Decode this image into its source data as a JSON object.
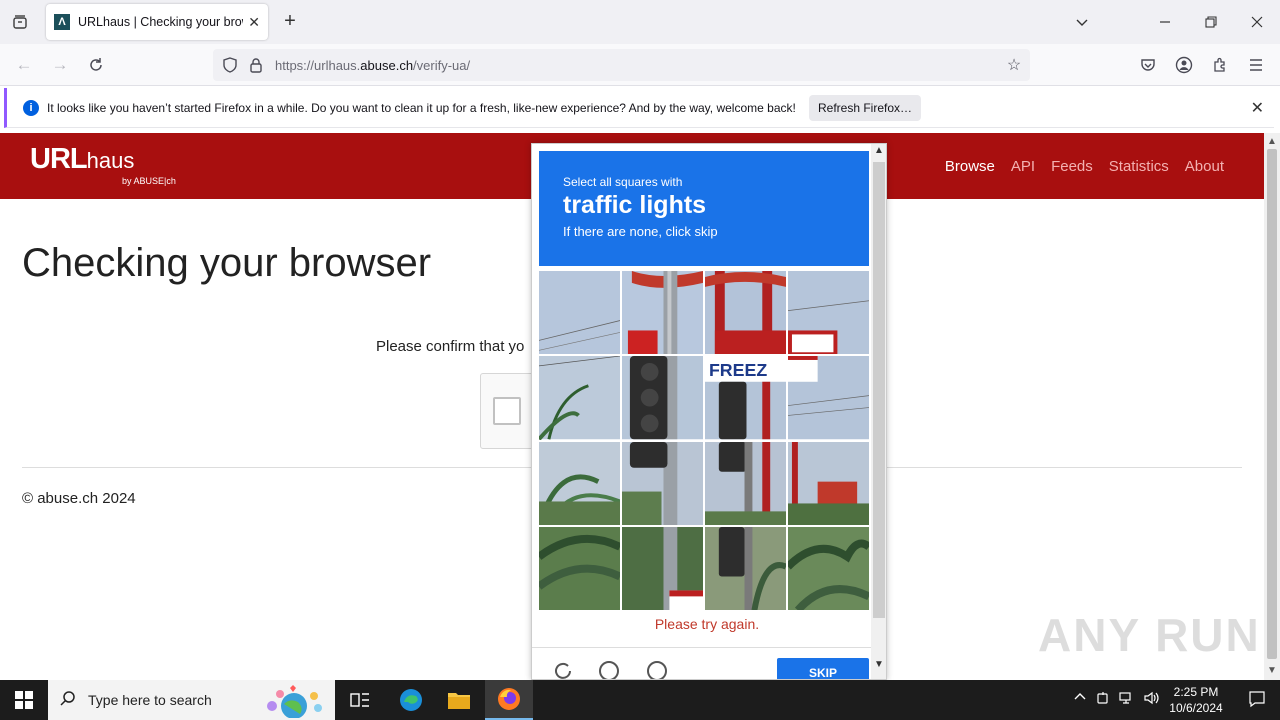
{
  "browser": {
    "tab_title": "URLhaus | Checking your browser",
    "url_prefix": "https://urlhaus.",
    "url_domain": "abuse.ch",
    "url_path": "/verify-ua/"
  },
  "notification": {
    "message": "It looks like you haven’t started Firefox in a while. Do you want to clean it up for a fresh, like-new experience? And by the way, welcome back!",
    "button_label": "Refresh Firefox…"
  },
  "site": {
    "logo_main": "URL",
    "logo_sub": "haus",
    "logo_by": "by ABUSE|ch",
    "nav": [
      {
        "label": "Browse"
      },
      {
        "label": "API"
      },
      {
        "label": "Feeds"
      },
      {
        "label": "Statistics"
      },
      {
        "label": "About"
      }
    ],
    "heading": "Checking your browser",
    "confirm_text": "Please confirm that yo",
    "copyright": "© abuse.ch 2024",
    "watermark": "ANY RUN"
  },
  "captcha": {
    "line1": "Select all squares with",
    "line2": "traffic lights",
    "line3": "If there are none, click skip",
    "error": "Please try again.",
    "skip_label": "SKIP",
    "accent": "#1a73e8"
  },
  "taskbar": {
    "search_placeholder": "Type here to search",
    "time": "2:25 PM",
    "date": "10/6/2024"
  }
}
